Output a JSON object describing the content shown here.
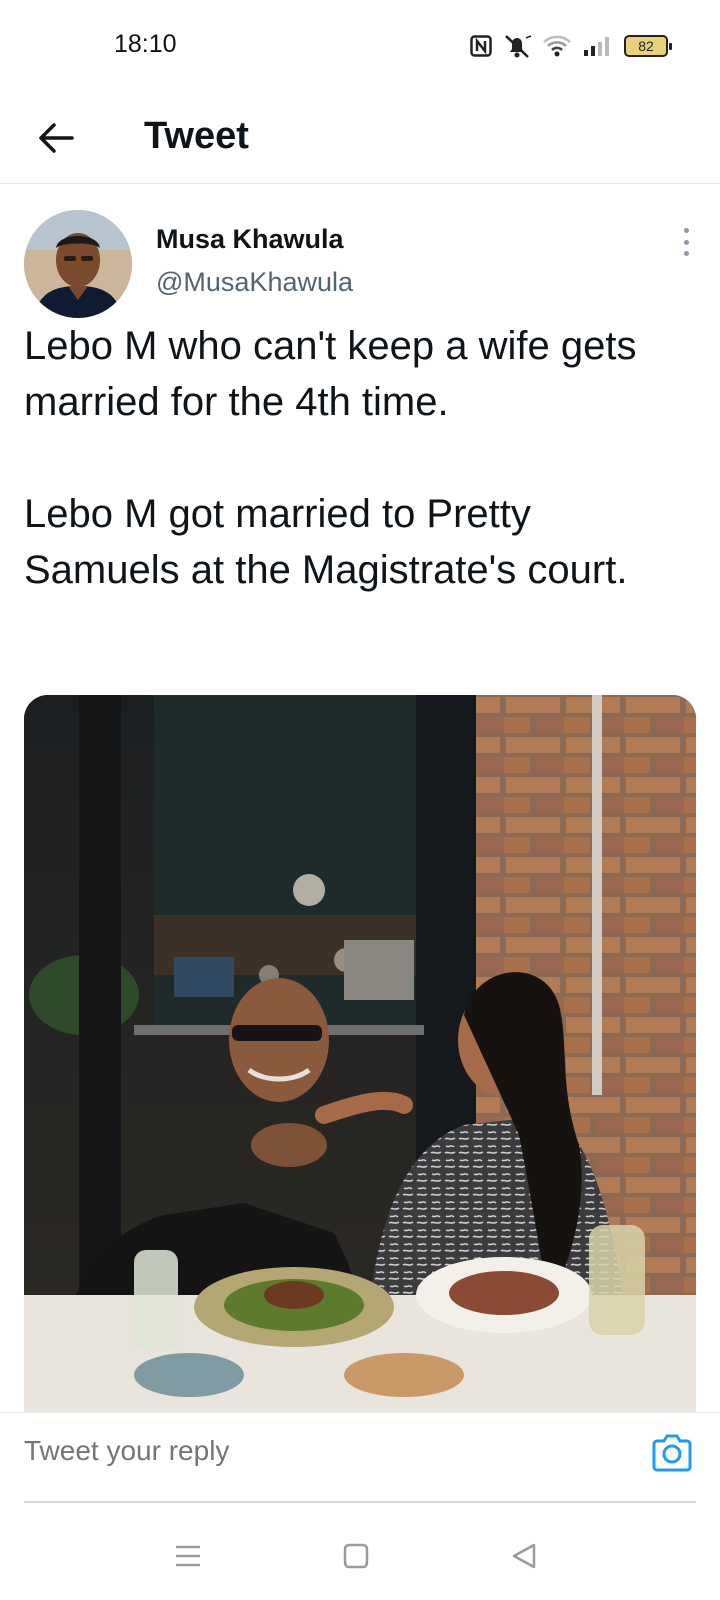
{
  "status_bar": {
    "time": "18:10",
    "icons": [
      "nfc-icon",
      "mute-icon",
      "wifi-icon",
      "signal-icon"
    ],
    "battery": "82"
  },
  "header": {
    "back_icon": "back-arrow-icon",
    "title": "Tweet"
  },
  "tweet": {
    "author_name": "Musa Khawula",
    "author_handle": "@MusaKhawula",
    "more_icon": "more-vertical-icon",
    "paragraphs": [
      "Lebo M who can't keep a wife gets married for the 4th time.",
      "Lebo M got married to Pretty Samuels at the Magistrate's court."
    ]
  },
  "reply": {
    "placeholder": "Tweet your reply",
    "camera_icon": "camera-icon",
    "accent_color": "#1d9bf0"
  },
  "nav_bar": {
    "icons": [
      "menu-icon",
      "home-square-icon",
      "back-triangle-icon"
    ]
  }
}
